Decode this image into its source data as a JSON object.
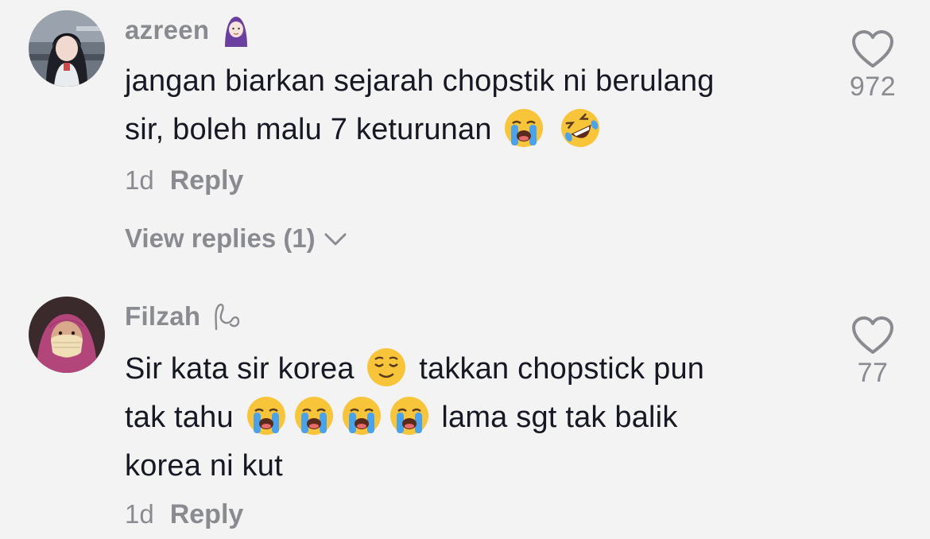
{
  "colors": {
    "background": "#f3f3f3",
    "text_primary": "#161823",
    "text_secondary": "#8a8b91"
  },
  "comments": [
    {
      "username": "azreen",
      "username_badge_icon": "person-in-headscarf-emoji",
      "text_lines": [
        "jangan biarkan sejarah chopstik ni berulang",
        "sir, boleh malu 7 keturunan"
      ],
      "inline_emoji_icons": [
        "loudly-crying-face-emoji",
        "rolling-on-floor-laughing-emoji"
      ],
      "timestamp": "1d",
      "reply_label": "Reply",
      "view_replies_label": "View replies (1)",
      "like_icon": "heart-outline-icon",
      "like_count": "972"
    },
    {
      "username": "Filzah",
      "username_badge_icon": "decorative-swirl-glyph",
      "text_segments": [
        "Sir kata sir korea",
        "takkan chopstick pun",
        "tak tahu",
        "lama sgt tak balik",
        "korea ni kut"
      ],
      "inline_emoji_icons": [
        "relieved-face-emoji",
        "loudly-crying-face-emoji",
        "loudly-crying-face-emoji",
        "loudly-crying-face-emoji",
        "loudly-crying-face-emoji"
      ],
      "timestamp": "1d",
      "reply_label": "Reply",
      "like_icon": "heart-outline-icon",
      "like_count": "77"
    }
  ]
}
